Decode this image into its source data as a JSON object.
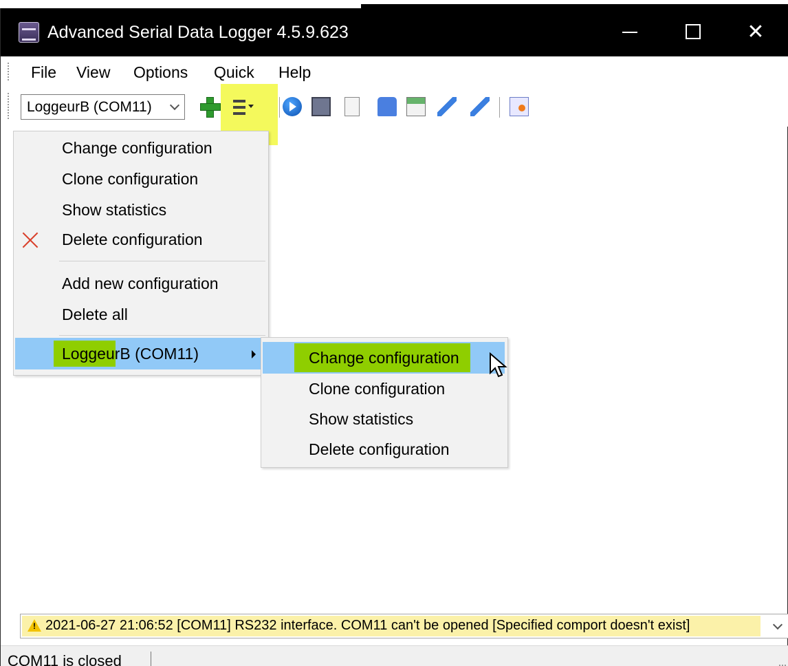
{
  "app": {
    "title": "Advanced Serial Data Logger 4.5.9.623",
    "icon": "serial-logger-app-icon"
  },
  "window_controls": {
    "minimize": "minimize-icon",
    "maximize": "maximize-icon",
    "close": "close-icon",
    "close_glyph": "✕"
  },
  "menubar": {
    "items": [
      "File",
      "View",
      "Options",
      "Quick",
      "Help"
    ]
  },
  "toolbar": {
    "config_combo": {
      "selected": "LoggeurB (COM11)"
    },
    "icons": [
      "add-icon",
      "configurations-list-icon",
      "start-icon",
      "port-chip-icon",
      "document-icon",
      "monitor-icon",
      "scheduler-icon",
      "filter-icon",
      "filter-add-icon",
      "copy-icon"
    ]
  },
  "main_menu": {
    "items": [
      {
        "label": "Change configuration"
      },
      {
        "label": "Clone configuration"
      },
      {
        "label": "Show statistics"
      },
      {
        "label": "Delete configuration",
        "icon": "delete-x-icon"
      },
      {
        "label": "Add new configuration"
      },
      {
        "label": "Delete all"
      },
      {
        "label": "LoggeurB (COM11)",
        "has_submenu": true,
        "selected": true
      }
    ]
  },
  "sub_menu": {
    "items": [
      {
        "label": "Change configuration",
        "selected": true
      },
      {
        "label": "Clone configuration"
      },
      {
        "label": "Show statistics"
      },
      {
        "label": "Delete configuration"
      }
    ]
  },
  "log": {
    "message": "2021-06-27 21:06:52 [COM11] RS232 interface. COM11 can't be opened [Specified comport doesn't exist]",
    "icon": "warning-icon"
  },
  "status": {
    "text": "COM11 is closed"
  },
  "colors": {
    "titlebar": "#000000",
    "selection": "#91c9f7",
    "highlight_green": "#8fce00",
    "highlight_yellow": "#f4f95c",
    "log_highlight": "#fbf1a9",
    "delete_red": "#d9402b"
  }
}
